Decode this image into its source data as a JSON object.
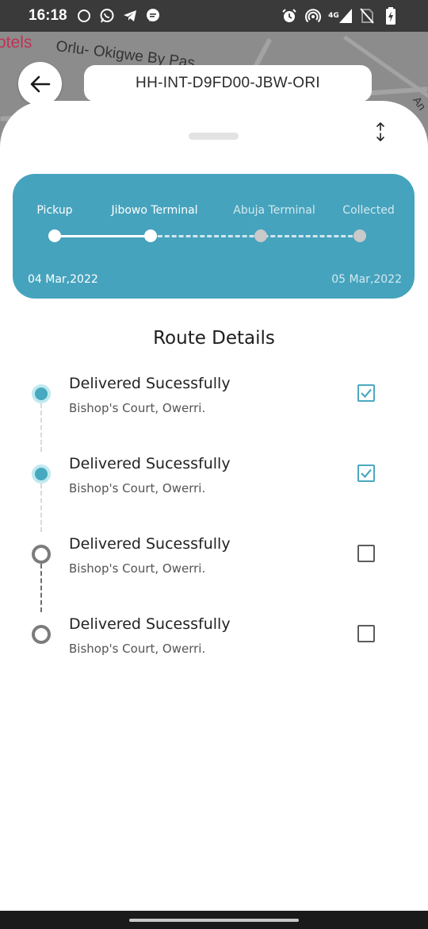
{
  "status_bar": {
    "time": "16:18",
    "network": "4G",
    "left_icons": [
      "circle-notification-icon",
      "whatsapp-icon",
      "telegram-icon",
      "chat-bubble-icon"
    ],
    "right_icons": [
      "alarm-icon",
      "hotspot-icon",
      "signal-icon",
      "no-sim-icon",
      "battery-icon"
    ]
  },
  "map": {
    "hotels_label": "otels",
    "road_label": "Orlu- Okigwe By Pas",
    "corner_label": "An"
  },
  "header": {
    "back_icon": "arrow-left-icon",
    "tracking_id": "HH-INT-D9FD00-JBW-ORI"
  },
  "sheet": {
    "expand_icon": "vertical-expand-icon"
  },
  "progress": {
    "stages": [
      {
        "label": "Pickup",
        "reached": true
      },
      {
        "label": "Jibowo Terminal",
        "reached": true
      },
      {
        "label": "Abuja Terminal",
        "reached": false
      },
      {
        "label": "Collected",
        "reached": false
      }
    ],
    "start_date": "04 Mar,2022",
    "end_date": "05 Mar,2022",
    "colors": {
      "card": "#46a3bd",
      "active": "#ffffff",
      "inactive": "#c9c9c9"
    }
  },
  "route": {
    "title": "Route Details",
    "items": [
      {
        "title": "Delivered Sucessfully",
        "location": "Bishop's Court, Owerri.",
        "checked": true
      },
      {
        "title": "Delivered Sucessfully",
        "location": "Bishop's Court, Owerri.",
        "checked": true
      },
      {
        "title": "Delivered Sucessfully",
        "location": "Bishop's Court, Owerri.",
        "checked": false
      },
      {
        "title": "Delivered Sucessfully",
        "location": "Bishop's Court, Owerri.",
        "checked": false
      }
    ],
    "colors": {
      "done": "#46a9c0",
      "pending": "#7c7c7c"
    }
  }
}
